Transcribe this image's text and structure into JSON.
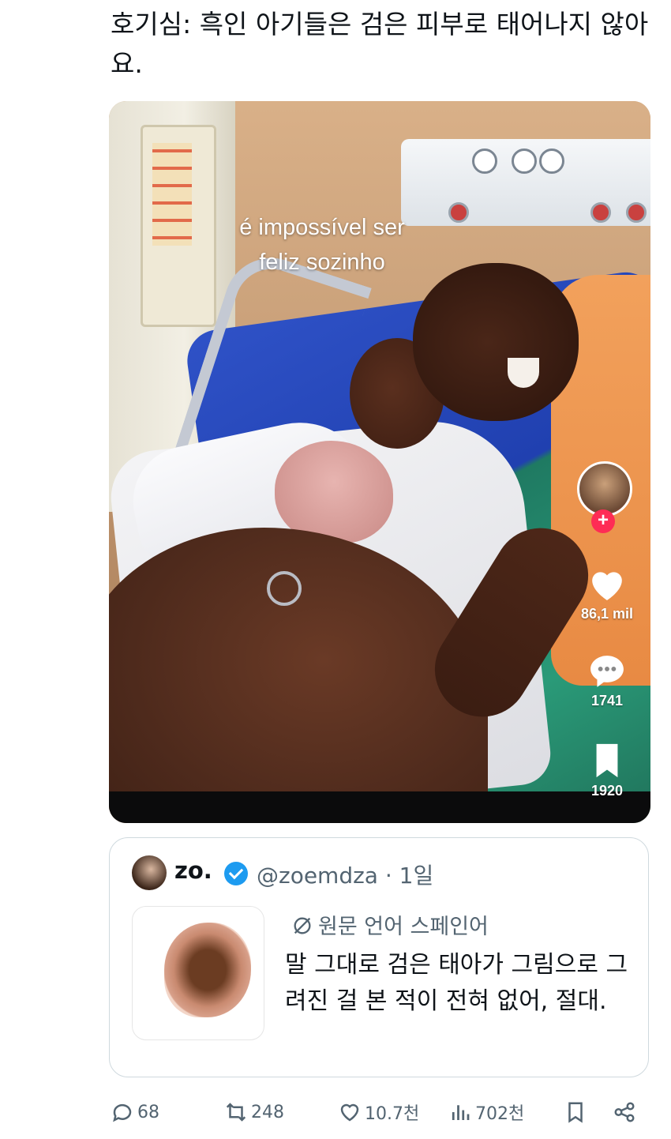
{
  "tweet": {
    "text": "호기심: 흑인 아기들은 검은 피부로 태어나지 않아요."
  },
  "video": {
    "caption": "é impossível ser feliz sozinho",
    "likes": "86,1 mil",
    "comments": "1741",
    "bookmarks": "1920"
  },
  "quote": {
    "name": "zo.",
    "handle": "@zoemdza · 1일",
    "translated_from": "원문 언어 스페인어",
    "body": "말 그대로 검은 태아가 그림으로 그려진 걸 본 적이 전혀 없어, 절대."
  },
  "actions": {
    "replies": "68",
    "reposts": "248",
    "likes": "10.7천",
    "views": "702천"
  },
  "colors": {
    "accent": "#1d9bf0",
    "muted": "#536471",
    "tiktok_plus": "#fe2c55"
  }
}
